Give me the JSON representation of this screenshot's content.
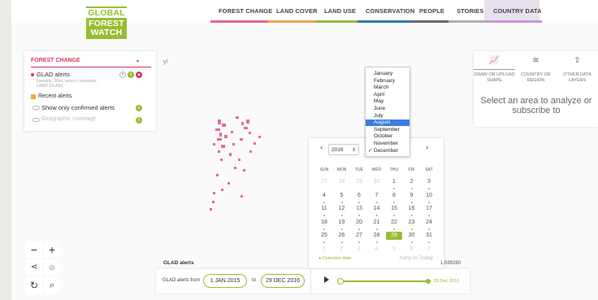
{
  "logo": {
    "line1": "GLOBAL",
    "line2": "FOREST",
    "line3": "WATCH"
  },
  "nav": [
    {
      "label": "FOREST CHANGE",
      "color": "#e7668b"
    },
    {
      "label": "LAND COVER",
      "color": "#e9a84f"
    },
    {
      "label": "LAND USE",
      "color": "#95b93a"
    },
    {
      "label": "CONSERVATION",
      "color": "#2c7fa7"
    },
    {
      "label": "PEOPLE",
      "color": "#6a6a6a"
    },
    {
      "label": "STORIES",
      "color": "#b0b0b0"
    },
    {
      "label": "COUNTRY DATA",
      "color": "#c796d8"
    }
  ],
  "forest_panel": {
    "title": "FOREST CHANGE",
    "layer": "GLAD alerts",
    "layer_sub": "(weekly, 30m, select countries, UMD/ GLAD)",
    "recent": "Recent alerts",
    "option_confirmed": "Show only confirmed alerts",
    "option_coverage": "Geographic coverage",
    "stray_text": "y!"
  },
  "right_panel": {
    "tabs": [
      {
        "label": "DRAW OR UPLOAD SHAPE",
        "icon": "chart-icon"
      },
      {
        "label": "COUNTRY OR REGION",
        "icon": "layers-icon"
      },
      {
        "label": "OTHER DATA LAYERS",
        "icon": "upload-icon"
      }
    ],
    "message": "Select an area to analyze or subscribe to"
  },
  "months": [
    "January",
    "February",
    "March",
    "April",
    "May",
    "June",
    "July",
    "August",
    "September",
    "October",
    "November",
    "December"
  ],
  "selected_month": "August",
  "checked_month": "December",
  "calendar": {
    "year": "2016",
    "weekdays": [
      "SUN",
      "MON",
      "TUE",
      "WED",
      "THU",
      "FRI",
      "SAT"
    ],
    "weeks": [
      [
        "27",
        "28",
        "29",
        "30",
        "1",
        "2",
        "3"
      ],
      [
        "4",
        "5",
        "6",
        "7",
        "8",
        "9",
        "10"
      ],
      [
        "11",
        "12",
        "13",
        "14",
        "15",
        "16",
        "17"
      ],
      [
        "18",
        "19",
        "20",
        "21",
        "22",
        "23",
        "24"
      ],
      [
        "25",
        "26",
        "27",
        "28",
        "29",
        "30",
        "31"
      ],
      [
        "1",
        "2",
        "3",
        "4",
        "5",
        "6",
        "7"
      ]
    ],
    "selected_day": "29",
    "footer_left": "Detection date",
    "footer_right": "Jump to Today"
  },
  "coords": "1.599280",
  "timeline": {
    "title": "GLAD alerts",
    "label": "GLAD alerts from",
    "from": "1 JAN 2015",
    "to_word": "to",
    "to": "29 DEC 2016",
    "end_label": "29 Dec 2016",
    "progress": 1.0
  },
  "accent": "#97be32"
}
